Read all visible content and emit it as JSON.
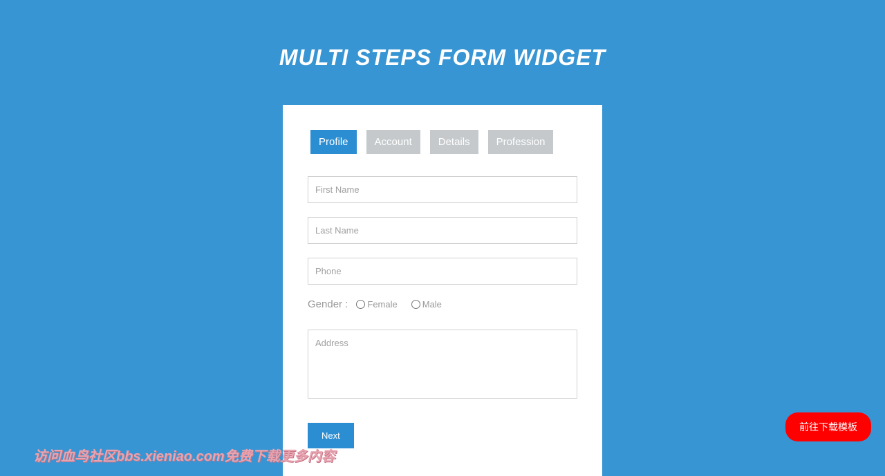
{
  "title": "MULTI STEPS FORM WIDGET",
  "tabs": [
    {
      "label": "Profile",
      "active": true
    },
    {
      "label": "Account",
      "active": false
    },
    {
      "label": "Details",
      "active": false
    },
    {
      "label": "Profession",
      "active": false
    }
  ],
  "form": {
    "firstName": {
      "placeholder": "First Name",
      "value": ""
    },
    "lastName": {
      "placeholder": "Last Name",
      "value": ""
    },
    "phone": {
      "placeholder": "Phone",
      "value": ""
    },
    "genderLabel": "Gender :",
    "genderOptions": {
      "female": "Female",
      "male": "Male"
    },
    "address": {
      "placeholder": "Address",
      "value": ""
    },
    "nextButton": "Next"
  },
  "watermark": "访问血鸟社区bbs.xieniao.com免费下载更多内容",
  "downloadButton": "前往下载模板"
}
